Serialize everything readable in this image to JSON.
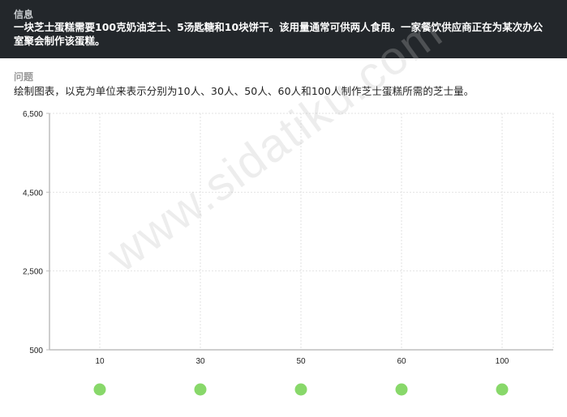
{
  "info": {
    "heading": "信息",
    "body": "一块芝士蛋糕需要100克奶油芝士、5汤匙糖和10块饼干。该用量通常可供两人食用。一家餐饮供应商正在为某次办公室聚会制作该蛋糕。"
  },
  "question": {
    "heading": "问题",
    "body": "绘制图表，以克为单位来表示分别为10人、30人、50人、60人和100人制作芝士蛋糕所需的芝士量。"
  },
  "chart_data": {
    "type": "scatter",
    "x_categories": [
      "10",
      "30",
      "50",
      "60",
      "100"
    ],
    "y_tick_labels": [
      "500",
      "2,500",
      "4,500",
      "6,500"
    ],
    "y_ticks": [
      500,
      2500,
      4500,
      6500
    ],
    "ylim": [
      500,
      6500
    ],
    "grid": true,
    "values": [
      null,
      null,
      null,
      null,
      null
    ],
    "handle_color": "#88d86a",
    "axis_color": "#bdbdbd",
    "grid_color": "#e2e2e2"
  },
  "watermark": "www.sidatiku.com"
}
